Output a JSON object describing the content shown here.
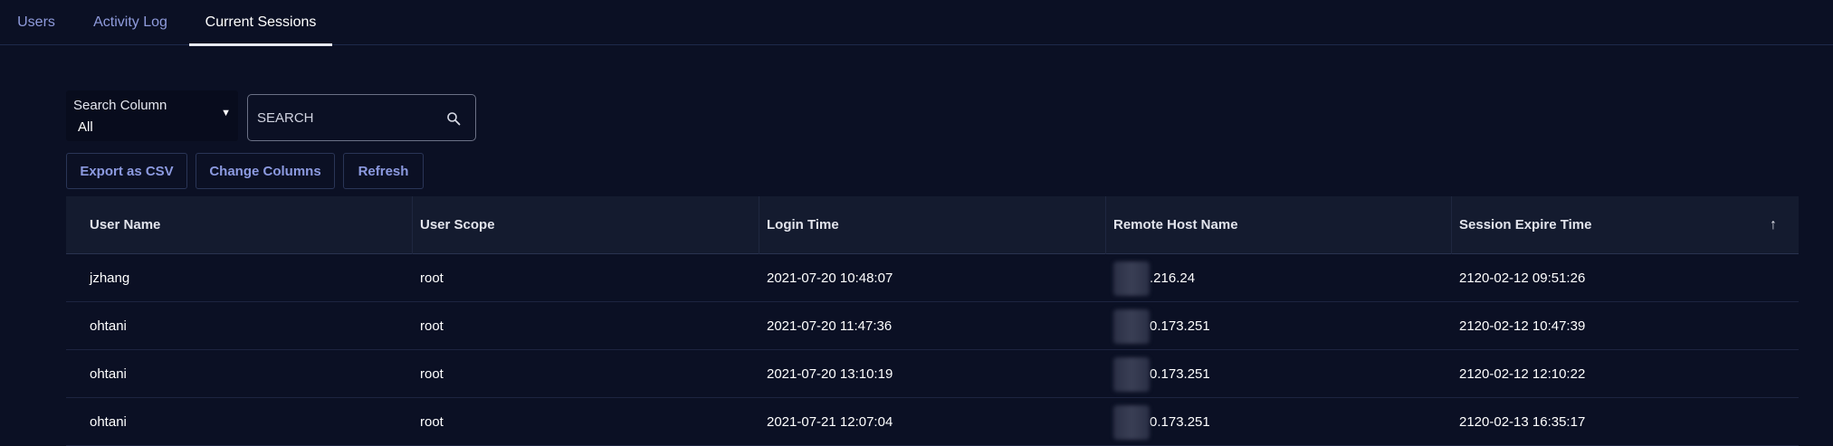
{
  "tabs": [
    {
      "label": "Users"
    },
    {
      "label": "Activity Log"
    },
    {
      "label": "Current Sessions"
    }
  ],
  "active_tab": "Current Sessions",
  "search_column": {
    "label": "Search Column",
    "value": "All"
  },
  "search": {
    "placeholder": "SEARCH",
    "value": ""
  },
  "toolbar": {
    "export_label": "Export as CSV",
    "columns_label": "Change Columns",
    "refresh_label": "Refresh"
  },
  "table": {
    "columns": [
      "User Name",
      "User Scope",
      "Login Time",
      "Remote Host Name",
      "Session Expire Time"
    ],
    "sort_icon": "arrow-up-icon",
    "rows": [
      {
        "user": "jzhang",
        "scope": "root",
        "login": "2021-07-20 10:48:07",
        "host": ".216.24",
        "expire": "2120-02-12 09:51:26"
      },
      {
        "user": "ohtani",
        "scope": "root",
        "login": "2021-07-20 11:47:36",
        "host": "0.173.251",
        "expire": "2120-02-12 10:47:39"
      },
      {
        "user": "ohtani",
        "scope": "root",
        "login": "2021-07-20 13:10:19",
        "host": "0.173.251",
        "expire": "2120-02-12 12:10:22"
      },
      {
        "user": "ohtani",
        "scope": "root",
        "login": "2021-07-21 12:07:04",
        "host": "0.173.251",
        "expire": "2120-02-13 16:35:17"
      }
    ]
  },
  "colors": {
    "background": "#0b1024",
    "accent": "#8c9ae0",
    "header_bg": "#141b2f"
  }
}
